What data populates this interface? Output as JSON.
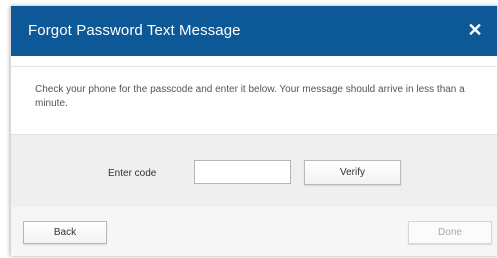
{
  "dialog": {
    "title": "Forgot Password Text Message",
    "close_label": "✕"
  },
  "message": "Check your phone for the passcode and enter it below. Your message should arrive in less than a minute.",
  "code_form": {
    "label": "Enter code",
    "input_value": "",
    "verify_label": "Verify"
  },
  "footer": {
    "back_label": "Back",
    "done_label": "Done"
  },
  "colors": {
    "titlebar": "#0d5896",
    "code_row_bg": "#efefef"
  }
}
